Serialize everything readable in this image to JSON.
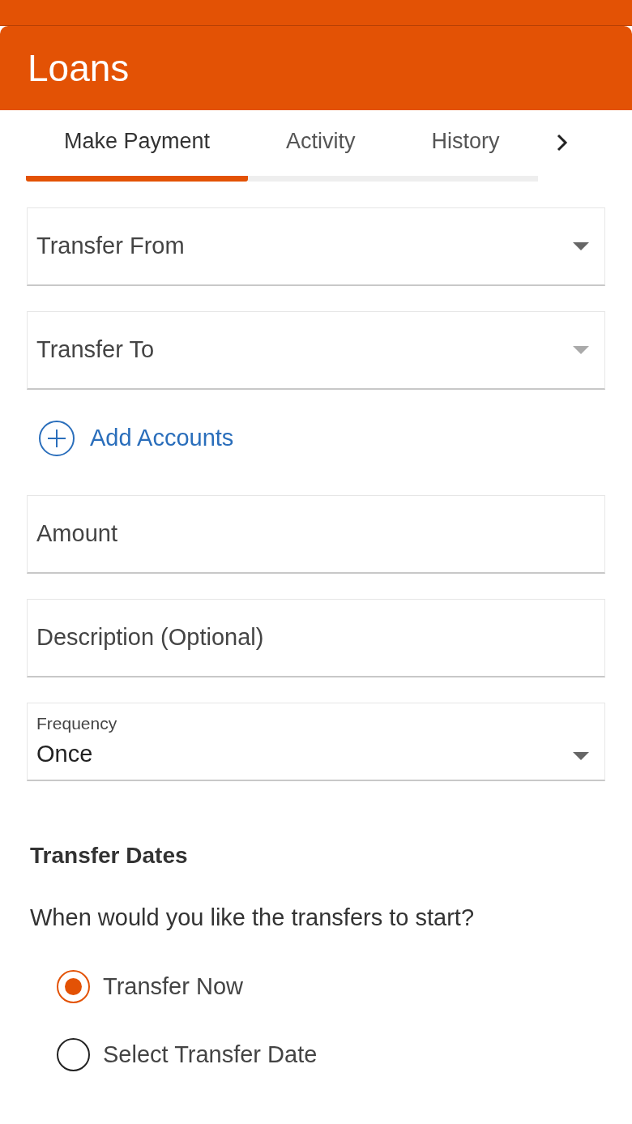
{
  "header": {
    "title": "Loans"
  },
  "tabs": [
    {
      "label": "Make Payment",
      "selected": true
    },
    {
      "label": "Activity",
      "selected": false
    },
    {
      "label": "History",
      "selected": false
    }
  ],
  "fields": [
    {
      "kind": "select",
      "placeholder": "Transfer From",
      "disabled": false
    },
    {
      "kind": "select",
      "placeholder": "Transfer To",
      "disabled": true
    },
    {
      "kind": "link",
      "label": "Add Accounts"
    },
    {
      "kind": "text",
      "placeholder": "Amount"
    },
    {
      "kind": "text",
      "placeholder": "Description (Optional)"
    },
    {
      "kind": "labeled_select",
      "label": "Frequency",
      "value": "Once",
      "disabled": false
    }
  ],
  "transfer_dates": {
    "heading": "Transfer Dates",
    "question": "When would you like the transfers to start?",
    "options": [
      {
        "label": "Transfer Now",
        "selected": true
      },
      {
        "label": "Select Transfer Date",
        "selected": false
      }
    ]
  }
}
